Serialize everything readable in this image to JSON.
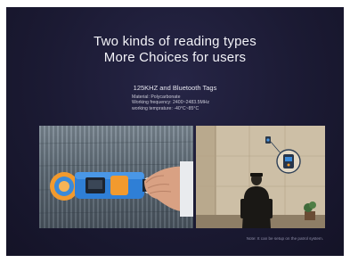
{
  "headline": {
    "line1": "Two kinds of reading types",
    "line2": "More Choices for users"
  },
  "subhead": "125KHZ and Bluetooth Tags",
  "specs": {
    "material": "Material: Polycarbonate",
    "frequency": "Working frequency: 2400~2483.5MHz",
    "temperature": "working temprature: -40°C~85°C"
  },
  "caption": "Note: It can be setup on the patrol system.",
  "colors": {
    "background": "#1b1a33",
    "device_body": "#2f7fd6",
    "device_accent": "#f29a2e"
  }
}
